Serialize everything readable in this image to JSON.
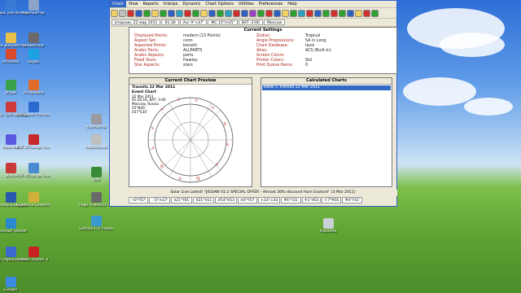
{
  "desktop": {
    "icons": [
      {
        "label": "Ярлык для Интернет",
        "color": "#3a7bd5"
      },
      {
        "label": "Компьютер",
        "color": "#8aa5c8"
      },
      {
        "label": "Мои документы",
        "color": "#e8c04a"
      },
      {
        "label": "ShowerStar",
        "color": "#6a6a6a"
      },
      {
        "label": "Activetex",
        "color": "#d84a2a"
      },
      {
        "label": "Skype",
        "color": "#1aa3e0"
      },
      {
        "label": "Игры",
        "color": "#3aa04a"
      },
      {
        "label": "Установка",
        "color": "#e06a2a"
      },
      {
        "label": "Daily Task Manager",
        "color": "#d03a3a"
      },
      {
        "label": "PDFSaver Pro Pack",
        "color": "#2a6ad0"
      },
      {
        "label": "Контакты",
        "color": "#9a9aa0"
      },
      {
        "label": "Kalendar",
        "color": "#5a5ae0"
      },
      {
        "label": "PDF-XChange Viewer",
        "color": "#c82a2a"
      },
      {
        "label": "Autoskycalc",
        "color": "#c0c0c0"
      },
      {
        "label": "photo",
        "color": "#c83a3a"
      },
      {
        "label": "PDF-XChange Sidebar",
        "color": "#4a8ad0"
      },
      {
        "label": "Qtd",
        "color": "#3a8a3a"
      },
      {
        "label": "Astrolog BlueSpeed",
        "color": "#2a5ab0"
      },
      {
        "label": "Quintana Seventh",
        "color": "#d0b03a"
      },
      {
        "label": "Page Protector Platinum",
        "color": "#6a6a6a"
      },
      {
        "label": "CodeStuff Starter",
        "color": "#2a8ad0"
      },
      {
        "label": "Sothink FLV Player",
        "color": "#3a9ad0"
      },
      {
        "label": "Корзина",
        "color": "#c8d0d8"
      },
      {
        "label": "Reg Organizer (ключи)",
        "color": "#3a6ad0"
      },
      {
        "label": "Adobe Reader X",
        "color": "#c82020"
      },
      {
        "label": "Google",
        "color": "#3a8ae0"
      }
    ]
  },
  "app": {
    "menu": [
      "Chart",
      "View",
      "Reports",
      "Interps",
      "Dynamic",
      "Chart Options",
      "Utilities",
      "Preferences",
      "Help"
    ],
    "status": [
      "вторник, 22 мар 2011",
      "01:30",
      "Asc 9°×47'",
      "MC 15°m35'",
      "BAT -3:00",
      "Moscow"
    ],
    "settings": {
      "title": "Current Settings",
      "left": [
        {
          "k": "Displayed Points:",
          "v": "modern (13 Points)"
        },
        {
          "k": "Aspect Set:",
          "v": "conn"
        },
        {
          "k": "Aspected Points:",
          "v": "bonatti"
        },
        {
          "k": "Arabic Parts:",
          "v": "ALLPARTS"
        },
        {
          "k": "Arabic Aspects:",
          "v": "parts"
        },
        {
          "k": "Fixed Stars:",
          "v": "frawley"
        },
        {
          "k": "Star Aspects:",
          "v": "stars"
        }
      ],
      "right": [
        {
          "k": "Zodiac:",
          "v": "Tropical"
        },
        {
          "k": "Angle Progressions:",
          "v": "SA in Long"
        },
        {
          "k": "Chart Database:",
          "v": "lavoi"
        },
        {
          "k": "Atlas:",
          "v": "ACS (Built-in)"
        },
        {
          "k": "Screen Colors:",
          "v": ""
        },
        {
          "k": "Printer Colors:",
          "v": "Std"
        },
        {
          "k": "Print Queue Items:",
          "v": "0"
        }
      ]
    },
    "preview": {
      "title": "Current Chart Preview",
      "lines": [
        "Transits 22 Mar 2011",
        "Event Chart",
        "22 Mar 2011",
        "01:26:16, BAT -3:00",
        "Moscow, Russia",
        "55°N45'",
        "037°E35'"
      ]
    },
    "calculated": {
      "title": "Calculated Charts",
      "item": "Natal    1 Transits 22 Mar 2011"
    },
    "ticker": "Solar Live Latest! \"JIGSAW V2.2 SPECIAL OFFER - Almost 30% discount from Esotech\" (3 Mar 2011)",
    "planets": [
      "☉0°Y57'",
      "☽5°m17'",
      "☿21°Y01'",
      "♀21°H11",
      "♂14°H53",
      "♃0°Y57'",
      "♄14°≏33",
      "♅4°Y31'",
      "♆1°H53",
      "♇7°Ψ35",
      "♅4°Y31'"
    ]
  }
}
